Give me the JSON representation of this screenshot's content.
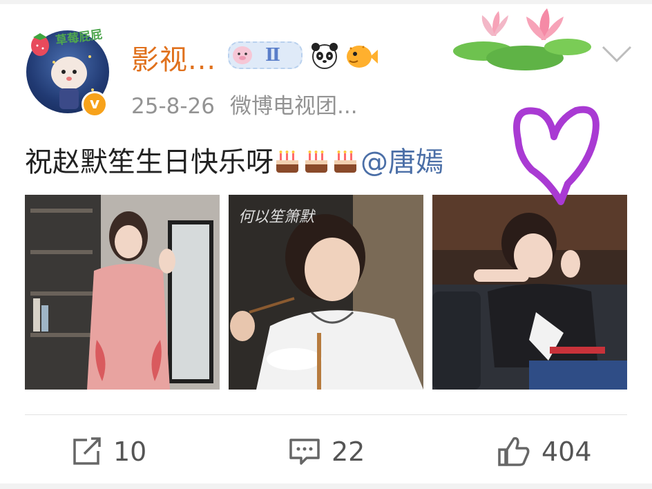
{
  "header": {
    "username": "影视...",
    "avatar_badge": "草莓屁屁",
    "level_badge": "Ⅱ",
    "timestamp": "25-8-26",
    "source": "微博电视团..."
  },
  "post": {
    "text": "祝赵默笙生日快乐呀",
    "mention": "@唐嫣"
  },
  "photos": [
    {
      "name": "photo-pink-dress",
      "caption": ""
    },
    {
      "name": "photo-eating",
      "caption": "何以笙箫默"
    },
    {
      "name": "photo-sofa-wave",
      "caption": ""
    }
  ],
  "actions": {
    "repost_count": "10",
    "comment_count": "22",
    "like_count": "404"
  },
  "colors": {
    "username": "#e0711d",
    "mention": "#4b6fa7",
    "heart_doodle": "#a93ad3",
    "meta": "#939393"
  },
  "icons": [
    "verified-v-icon",
    "panda-icon",
    "pufferfish-icon",
    "chevron-down-icon",
    "cake-icon",
    "repost-icon",
    "comment-icon",
    "like-icon"
  ]
}
